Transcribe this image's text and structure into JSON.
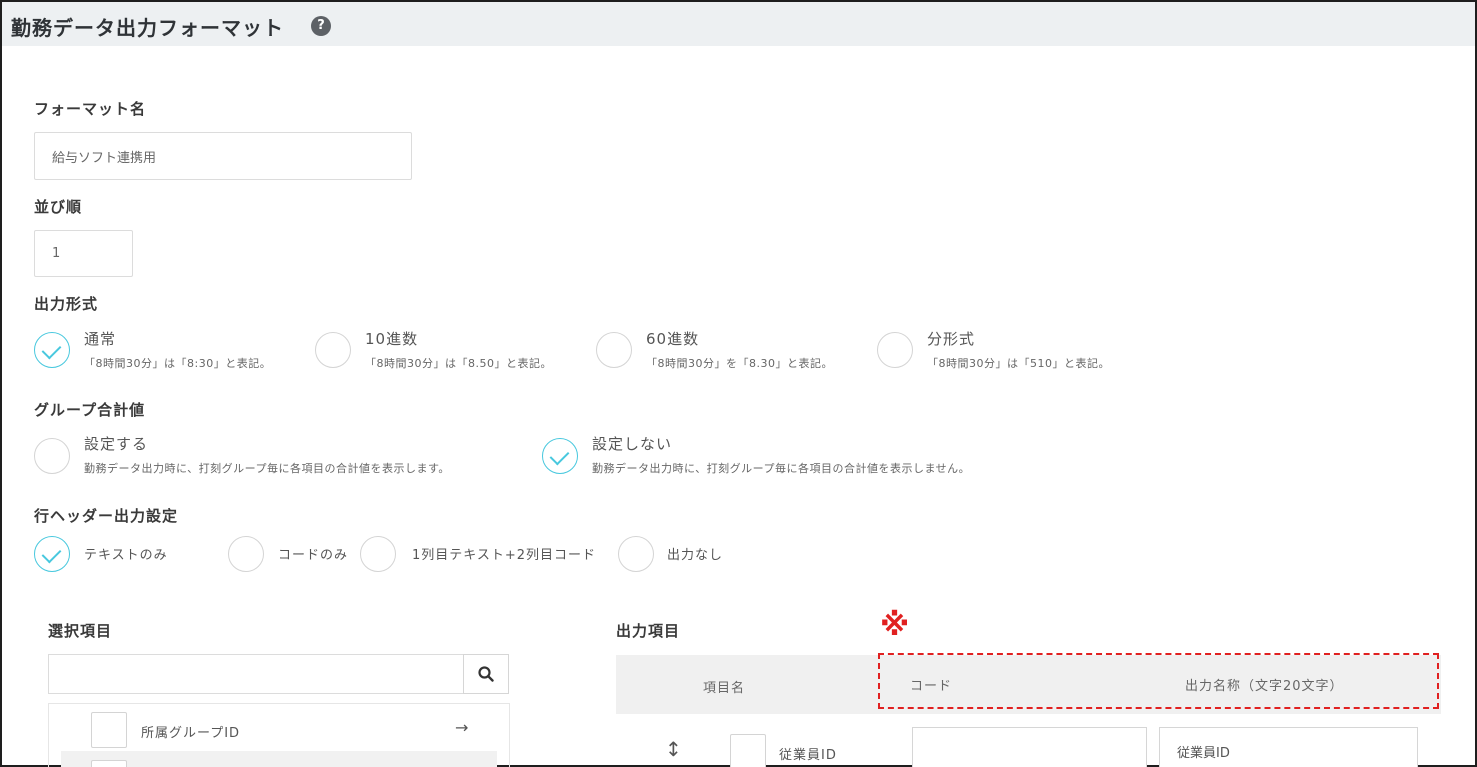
{
  "page": {
    "title": "勤務データ出力フォーマット",
    "help_glyph": "?"
  },
  "format_name": {
    "label": "フォーマット名",
    "value": "給与ソフト連携用"
  },
  "sort_order": {
    "label": "並び順",
    "value": "1"
  },
  "output_format": {
    "label": "出力形式",
    "options": [
      {
        "title": "通常",
        "desc": "「8時間30分」は「8:30」と表記。",
        "selected": true
      },
      {
        "title": "10進数",
        "desc": "「8時間30分」は「8.50」と表記。",
        "selected": false
      },
      {
        "title": "60進数",
        "desc": "「8時間30分」を「8.30」と表記。",
        "selected": false
      },
      {
        "title": "分形式",
        "desc": "「8時間30分」は「510」と表記。",
        "selected": false
      }
    ]
  },
  "group_total": {
    "label": "グループ合計値",
    "options": [
      {
        "title": "設定する",
        "desc": "勤務データ出力時に、打刻グループ毎に各項目の合計値を表示します。",
        "selected": false
      },
      {
        "title": "設定しない",
        "desc": "勤務データ出力時に、打刻グループ毎に各項目の合計値を表示しません。",
        "selected": true
      }
    ]
  },
  "row_header": {
    "label": "行ヘッダー出力設定",
    "options": [
      {
        "title": "テキストのみ",
        "selected": true
      },
      {
        "title": "コードのみ",
        "selected": false
      },
      {
        "title": "1列目テキスト+2列目コード",
        "selected": false
      },
      {
        "title": "出力なし",
        "selected": false
      }
    ]
  },
  "selection": {
    "label": "選択項目",
    "search_value": "",
    "search_icon": "search-icon",
    "items": [
      {
        "label": "所属グループID",
        "arrow": "→"
      }
    ]
  },
  "output_items": {
    "label": "出力項目",
    "note_mark": "※",
    "headers": {
      "name": "項目名",
      "code": "コード",
      "output_name": "出力名称（文字20文字）"
    },
    "rows": [
      {
        "handle": "↕",
        "name": "従業員ID",
        "code": "",
        "output_name": "従業員ID"
      }
    ]
  },
  "colors": {
    "accent": "#48c8de",
    "highlight": "#e02020"
  }
}
